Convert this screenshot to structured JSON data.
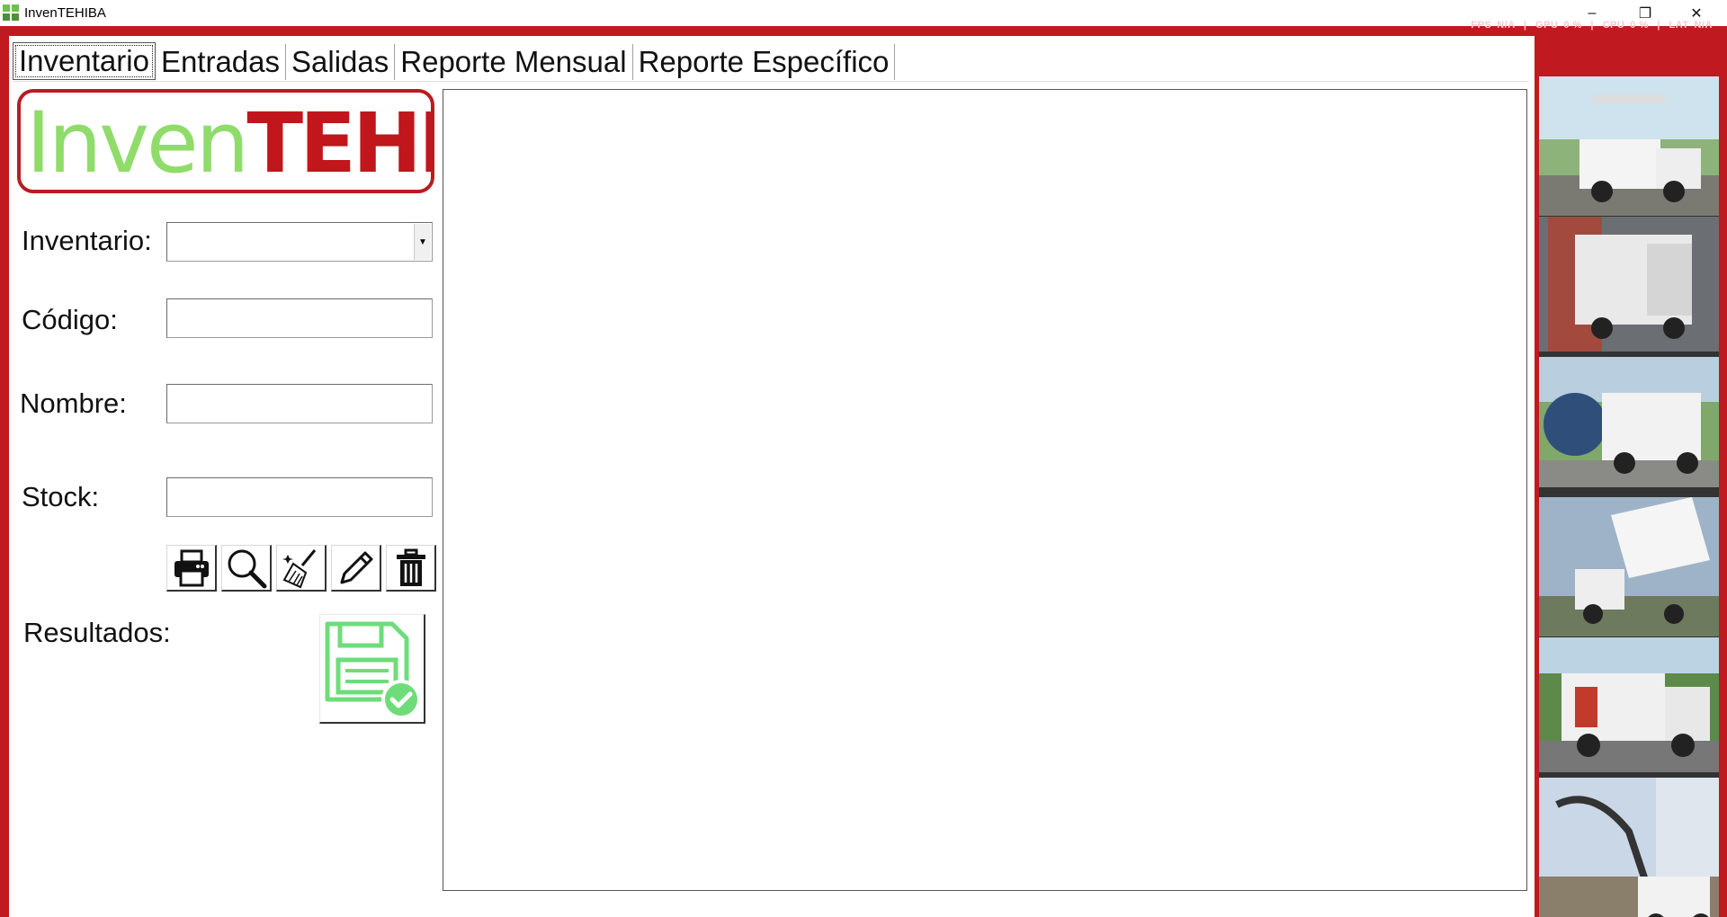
{
  "window": {
    "title": "InvenTEHIBA",
    "controls": {
      "minimize": "–",
      "maximize": "❐",
      "close": "✕"
    }
  },
  "overlay": {
    "fps_label": "FPS",
    "fps_value": "N/A",
    "gpu_label": "GPU",
    "gpu_value": "0 %",
    "cpu_label": "CPU",
    "cpu_value": "0 %",
    "lat_label": "LAT",
    "lat_value": "N/A"
  },
  "tabs": [
    {
      "label": "Inventario",
      "active": true
    },
    {
      "label": "Entradas",
      "active": false
    },
    {
      "label": "Salidas",
      "active": false
    },
    {
      "label": "Reporte Mensual",
      "active": false
    },
    {
      "label": "Reporte Específico",
      "active": false
    }
  ],
  "logo": {
    "part1": "Inven",
    "part2": "TEHIBA"
  },
  "form": {
    "inventario_label": "Inventario:",
    "inventario_value": "",
    "codigo_label": "Código:",
    "codigo_value": "",
    "nombre_label": "Nombre:",
    "nombre_value": "",
    "stock_label": "Stock:",
    "stock_value": ""
  },
  "toolbar": [
    "printer-icon",
    "search-icon",
    "broom-icon",
    "pencil-icon",
    "trash-icon"
  ],
  "results_label": "Resultados:",
  "colors": {
    "brand_red": "#c0191f",
    "logo_green": "#8fdc6a",
    "save_green": "#6fdc7a"
  },
  "gallery": [
    "bucket-truck-photo",
    "garbage-truck-photo",
    "sewer-cleaner-truck-photo",
    "dump-truck-photo",
    "service-truck-photo",
    "backhoe-truck-photo"
  ]
}
